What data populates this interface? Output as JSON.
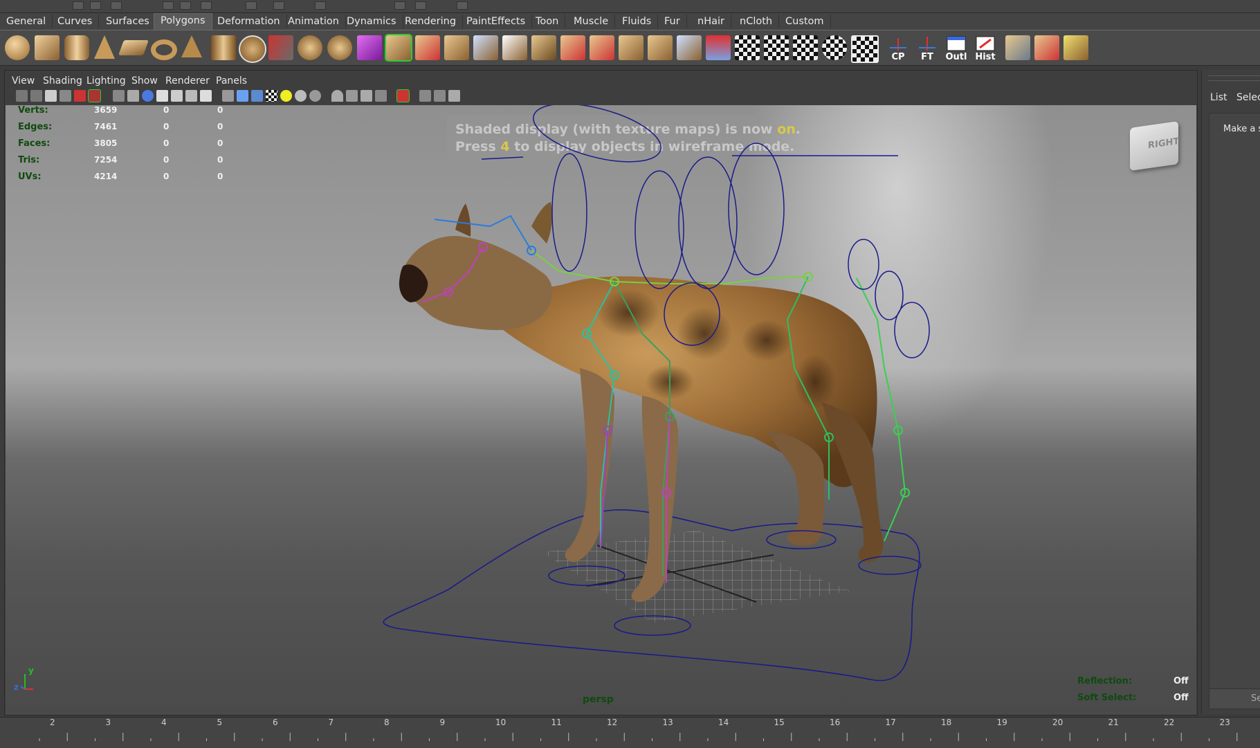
{
  "shelf_tabs": [
    "General",
    "Curves",
    "Surfaces",
    "Polygons",
    "Deformation",
    "Animation",
    "Dynamics",
    "Rendering",
    "PaintEffects",
    "Toon",
    "Muscle",
    "Fluids",
    "Fur",
    "nHair",
    "nCloth",
    "Custom"
  ],
  "active_shelf_tab": "Polygons",
  "shelf_labeled_icons": {
    "cp": "CP",
    "ft": "FT",
    "outl": "Outl",
    "hist": "Hist"
  },
  "panel_menu": [
    "View",
    "Shading",
    "Lighting",
    "Show",
    "Renderer",
    "Panels"
  ],
  "hud": {
    "rows": [
      {
        "label": "Verts:",
        "v1": "3659",
        "v2": "0",
        "v3": "0"
      },
      {
        "label": "Edges:",
        "v1": "7461",
        "v2": "0",
        "v3": "0"
      },
      {
        "label": "Faces:",
        "v1": "3805",
        "v2": "0",
        "v3": "0"
      },
      {
        "label": "Tris:",
        "v1": "7254",
        "v2": "0",
        "v3": "0"
      },
      {
        "label": "UVs:",
        "v1": "4214",
        "v2": "0",
        "v3": "0"
      }
    ]
  },
  "message": {
    "line1_a": "Shaded display (with texture maps) is now ",
    "line1_hl": "on",
    "line1_b": ".",
    "line2_a": "Press ",
    "line2_hl": "4",
    "line2_b": " to display objects in wireframe mode."
  },
  "view_cube_label": "RIGHT",
  "camera_label": "persp",
  "status": {
    "reflection_label": "Reflection:",
    "reflection_value": "Off",
    "softselect_label": "Soft Select:",
    "softselect_value": "Off"
  },
  "axis": {
    "y": "y",
    "z": "z"
  },
  "right_panel": {
    "tab_list": "List",
    "tab_select": "Selecti",
    "hint": "Make a se",
    "button": "Se"
  },
  "timeline_ticks": [
    "2",
    "3",
    "4",
    "5",
    "6",
    "7",
    "8",
    "9",
    "10",
    "11",
    "12",
    "13",
    "14",
    "15",
    "16",
    "17",
    "18",
    "19",
    "20",
    "21",
    "22",
    "23"
  ],
  "colors": {
    "accent_green": "#2ecc2e",
    "hud_label": "#0f4a0f",
    "curve_blue": "#1a1a8a"
  }
}
